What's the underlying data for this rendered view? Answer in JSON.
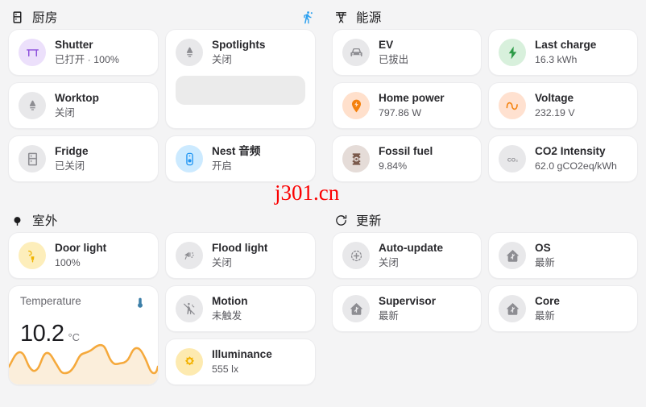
{
  "watermark": "j301.cn",
  "sections": {
    "kitchen": {
      "title": "厨房",
      "icon": "fridge-icon",
      "action_icon": "walking-person-icon",
      "cards": [
        {
          "name": "Shutter",
          "state": "已打开 · 100%",
          "icon": "shutter-icon",
          "color": "purple"
        },
        {
          "name": "Spotlights",
          "state": "关闭",
          "icon": "spotlight-icon",
          "color": "grey"
        },
        {
          "name": "Worktop",
          "state": "关闭",
          "icon": "spotlight-icon",
          "color": "grey"
        },
        {
          "name": "Fridge",
          "state": "已关闭",
          "icon": "fridge-icon",
          "color": "grey"
        },
        {
          "name": "Nest 音频",
          "state": "开启",
          "icon": "speaker-icon",
          "color": "blue"
        }
      ]
    },
    "energy": {
      "title": "能源",
      "icon": "transmission-tower-icon",
      "cards": [
        {
          "name": "EV",
          "state": "已拔出",
          "icon": "car-icon",
          "color": "grey"
        },
        {
          "name": "Last charge",
          "state": "16.3 kWh",
          "icon": "lightning-icon",
          "color": "green"
        },
        {
          "name": "Home power",
          "state": "797.86 W",
          "icon": "power-plug-icon",
          "color": "orange"
        },
        {
          "name": "Voltage",
          "state": "232.19 V",
          "icon": "sine-wave-icon",
          "color": "peach"
        },
        {
          "name": "Fossil fuel",
          "state": "9.84%",
          "icon": "barrel-icon",
          "color": "brown"
        },
        {
          "name": "CO2 Intensity",
          "state": "62.0 gCO2eq/kWh",
          "icon": "co2-icon",
          "color": "grey"
        }
      ]
    },
    "outdoor": {
      "title": "室外",
      "icon": "tree-icon",
      "cards": [
        {
          "name": "Door light",
          "state": "100%",
          "icon": "door-light-icon",
          "color": "yellow"
        },
        {
          "name": "Flood light",
          "state": "关闭",
          "icon": "flood-light-icon",
          "color": "grey"
        },
        {
          "name": "Motion",
          "state": "未触发",
          "icon": "motion-off-icon",
          "color": "grey"
        },
        {
          "name": "Illuminance",
          "state": "555 lx",
          "icon": "brightness-icon",
          "color": "yellow2"
        }
      ],
      "temperature": {
        "label": "Temperature",
        "value": "10.2",
        "unit": "°C",
        "icon": "thermometer-icon",
        "line_color": "#f5a93c",
        "fill_color": "#fdf0dd"
      }
    },
    "updates": {
      "title": "更新",
      "icon": "update-icon",
      "cards": [
        {
          "name": "Auto-update",
          "state": "关闭",
          "icon": "auto-update-icon",
          "color": "grey"
        },
        {
          "name": "OS",
          "state": "最新",
          "icon": "home-assistant-icon",
          "color": "grey"
        },
        {
          "name": "Supervisor",
          "state": "最新",
          "icon": "home-assistant-icon",
          "color": "grey"
        },
        {
          "name": "Core",
          "state": "最新",
          "icon": "home-assistant-icon",
          "color": "grey"
        }
      ]
    }
  }
}
